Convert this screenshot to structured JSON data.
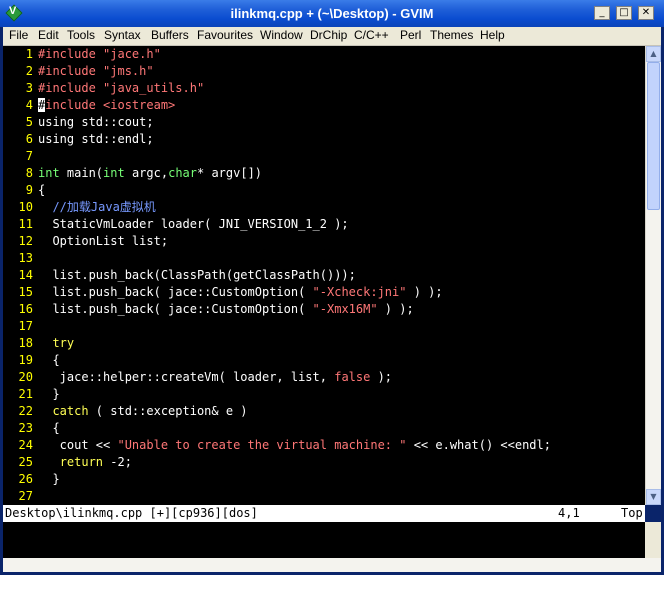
{
  "window": {
    "title": "ilinkmq.cpp + (~\\Desktop) - GVIM",
    "app_icon_letter": "V",
    "min_glyph": "_",
    "max_glyph": "□",
    "close_glyph": "✕"
  },
  "menu": [
    {
      "label": "File"
    },
    {
      "label": "Edit"
    },
    {
      "label": "Tools"
    },
    {
      "label": "Syntax"
    },
    {
      "label": "Buffers"
    },
    {
      "label": "Favourites"
    },
    {
      "label": "Window"
    },
    {
      "label": "DrChip"
    },
    {
      "label": "C/C++"
    },
    {
      "label": "Perl"
    },
    {
      "label": "Themes"
    },
    {
      "label": "Help"
    }
  ],
  "colors": {
    "line_number": "#ffff00",
    "preproc": "#ff7777",
    "string": "#ff7777",
    "normal": "#ffffff",
    "type": "#77ff77",
    "keyword": "#ffff55",
    "comment": "#7799ff",
    "constant": "#ff7777"
  },
  "lines": [
    {
      "n": "1",
      "tokens": [
        {
          "t": "#include ",
          "c": "preproc"
        },
        {
          "t": "\"jace.h\"",
          "c": "string"
        }
      ]
    },
    {
      "n": "2",
      "tokens": [
        {
          "t": "#include ",
          "c": "preproc"
        },
        {
          "t": "\"jms.h\"",
          "c": "string"
        }
      ]
    },
    {
      "n": "3",
      "tokens": [
        {
          "t": "#include ",
          "c": "preproc"
        },
        {
          "t": "\"java_utils.h\"",
          "c": "string"
        }
      ]
    },
    {
      "n": "4",
      "tokens": [
        {
          "t": "#",
          "c": "cursor"
        },
        {
          "t": "include ",
          "c": "preproc"
        },
        {
          "t": "<iostream>",
          "c": "string"
        }
      ]
    },
    {
      "n": "5",
      "tokens": [
        {
          "t": "using std::cout;",
          "c": "normal"
        }
      ]
    },
    {
      "n": "6",
      "tokens": [
        {
          "t": "using std::endl;",
          "c": "normal"
        }
      ]
    },
    {
      "n": "7",
      "tokens": []
    },
    {
      "n": "8",
      "tokens": [
        {
          "t": "int",
          "c": "type"
        },
        {
          "t": " main(",
          "c": "normal"
        },
        {
          "t": "int",
          "c": "type"
        },
        {
          "t": " argc,",
          "c": "normal"
        },
        {
          "t": "char",
          "c": "type"
        },
        {
          "t": "* argv[])",
          "c": "normal"
        }
      ]
    },
    {
      "n": "9",
      "tokens": [
        {
          "t": "{",
          "c": "normal"
        }
      ]
    },
    {
      "n": "10",
      "tokens": [
        {
          "t": "  //加载Java虚拟机",
          "c": "comment"
        }
      ]
    },
    {
      "n": "11",
      "tokens": [
        {
          "t": "  StaticVmLoader loader( JNI_VERSION_1_2 );",
          "c": "normal"
        }
      ]
    },
    {
      "n": "12",
      "tokens": [
        {
          "t": "  OptionList list;",
          "c": "normal"
        }
      ]
    },
    {
      "n": "13",
      "tokens": []
    },
    {
      "n": "14",
      "tokens": [
        {
          "t": "  list.push_back(ClassPath(getClassPath()));",
          "c": "normal"
        }
      ]
    },
    {
      "n": "15",
      "tokens": [
        {
          "t": "  list.push_back( jace::CustomOption( ",
          "c": "normal"
        },
        {
          "t": "\"-Xcheck:jni\"",
          "c": "string"
        },
        {
          "t": " ) );",
          "c": "normal"
        }
      ]
    },
    {
      "n": "16",
      "tokens": [
        {
          "t": "  list.push_back( jace::CustomOption( ",
          "c": "normal"
        },
        {
          "t": "\"-Xmx16M\"",
          "c": "string"
        },
        {
          "t": " ) );",
          "c": "normal"
        }
      ]
    },
    {
      "n": "17",
      "tokens": []
    },
    {
      "n": "18",
      "tokens": [
        {
          "t": "  ",
          "c": "normal"
        },
        {
          "t": "try",
          "c": "keyword"
        }
      ]
    },
    {
      "n": "19",
      "tokens": [
        {
          "t": "  {",
          "c": "normal"
        }
      ]
    },
    {
      "n": "20",
      "tokens": [
        {
          "t": "   jace::helper::createVm( loader, list, ",
          "c": "normal"
        },
        {
          "t": "false",
          "c": "constant"
        },
        {
          "t": " );",
          "c": "normal"
        }
      ]
    },
    {
      "n": "21",
      "tokens": [
        {
          "t": "  }",
          "c": "normal"
        }
      ]
    },
    {
      "n": "22",
      "tokens": [
        {
          "t": "  ",
          "c": "normal"
        },
        {
          "t": "catch",
          "c": "keyword"
        },
        {
          "t": " ( std::exception& e )",
          "c": "normal"
        }
      ]
    },
    {
      "n": "23",
      "tokens": [
        {
          "t": "  {",
          "c": "normal"
        }
      ]
    },
    {
      "n": "24",
      "tokens": [
        {
          "t": "   cout << ",
          "c": "normal"
        },
        {
          "t": "\"Unable to create the virtual machine: \"",
          "c": "string"
        },
        {
          "t": " << e.what() <<endl;",
          "c": "normal"
        }
      ]
    },
    {
      "n": "25",
      "tokens": [
        {
          "t": "   ",
          "c": "normal"
        },
        {
          "t": "return",
          "c": "keyword"
        },
        {
          "t": " -2;",
          "c": "normal"
        }
      ]
    },
    {
      "n": "26",
      "tokens": [
        {
          "t": "  }",
          "c": "normal"
        }
      ]
    },
    {
      "n": "27",
      "tokens": []
    }
  ],
  "status": {
    "file": "Desktop\\ilinkmq.cpp [+][cp936][dos]",
    "position": "4,1",
    "scroll": "Top"
  },
  "scrollbar": {
    "up_glyph": "▲",
    "down_glyph": "▼"
  }
}
